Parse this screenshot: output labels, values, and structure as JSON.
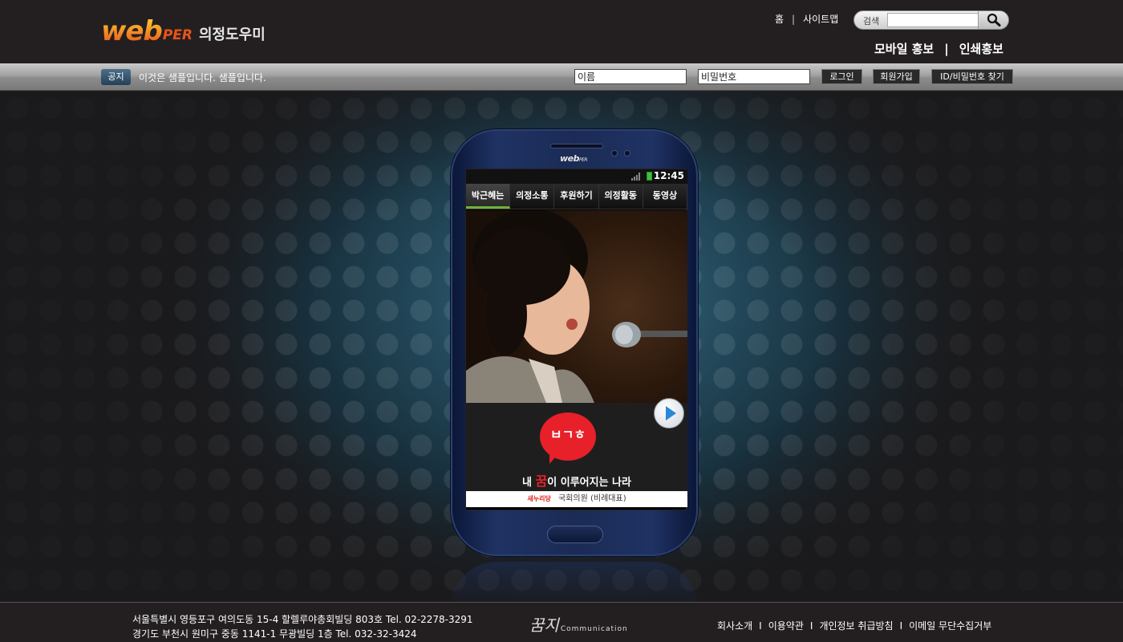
{
  "brand": {
    "web": "web",
    "per": "PER",
    "name": "의정도우미"
  },
  "topnav": {
    "home": "홈",
    "sitemap": "사이트맵",
    "separator": "|"
  },
  "search": {
    "label": "검색",
    "placeholder": ""
  },
  "mainnav": {
    "mobile": "모바일 홍보",
    "print": "인쇄홍보",
    "separator": "|"
  },
  "notice": {
    "badge": "공지",
    "text": "이것은 샘플입니다. 샘플입니다."
  },
  "login": {
    "name_value": "이름",
    "password_value": "비밀번호",
    "login_label": "로그인",
    "join_label": "회원가입",
    "find_label": "ID/비밀번호 찾기"
  },
  "phone": {
    "brand": "web",
    "brand_small": "PER",
    "time": "12:45",
    "tabs": [
      "박근혜는",
      "의정소통",
      "후원하기",
      "의정활동",
      "동영상"
    ],
    "bubble_text": "ㅂㄱㅎ",
    "slogan_pre": "내 ",
    "slogan_dream": "꿈",
    "slogan_post": "이 이루어지는 나라",
    "party": "새누리당",
    "position": "국회의원 (비례대표)"
  },
  "footer": {
    "address1": "서울특별시 영등포구 여의도동 15-4 할렐루야총회빌딩 803호 Tel. 02-2278-3291",
    "address2": "경기도 부천시 원미구 중동 1141-1 무광빌딩 1층 Tel. 032-32-3424",
    "comm_sig": "꿈지",
    "comm_word": "Communication",
    "links": [
      "회사소개",
      "이용약관",
      "개인정보 취급방침",
      "이메일 무단수집거부"
    ],
    "separator": "I"
  },
  "colors": {
    "accent": "#e8531a",
    "tab_active": "#6bb33a",
    "red": "#e8202a"
  }
}
